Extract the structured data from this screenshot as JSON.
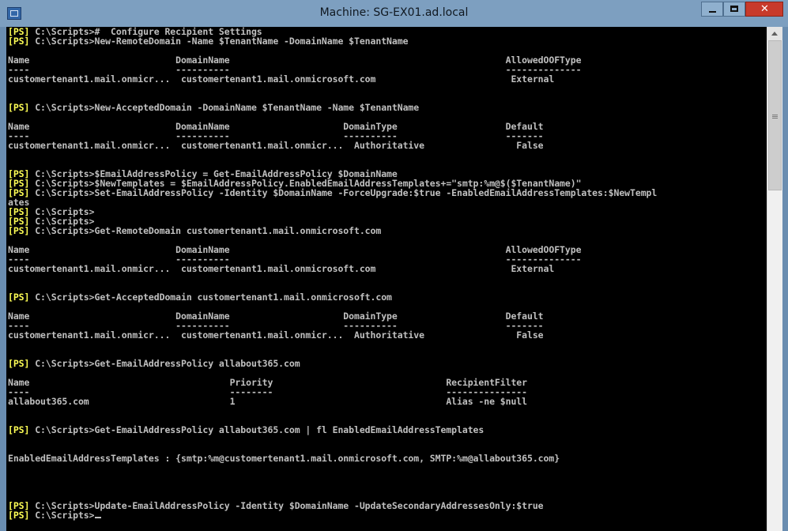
{
  "window": {
    "title": "Machine: SG-EX01.ad.local",
    "controls": {
      "minimize": "minimize",
      "maximize": "maximize",
      "close": "✕"
    }
  },
  "console": {
    "prompt_tag": "[PS]",
    "lines": [
      {
        "prompt": true,
        "text": " C:\\Scripts>#  Configure Recipient Settings"
      },
      {
        "prompt": true,
        "text": " C:\\Scripts>New-RemoteDomain -Name $TenantName -DomainName $TenantName"
      },
      {
        "prompt": false,
        "text": ""
      },
      {
        "prompt": false,
        "text": "Name                           DomainName                                                   AllowedOOFType"
      },
      {
        "prompt": false,
        "text": "----                           ----------                                                   --------------"
      },
      {
        "prompt": false,
        "text": "customertenant1.mail.onmicr...  customertenant1.mail.onmicrosoft.com                         External"
      },
      {
        "prompt": false,
        "text": ""
      },
      {
        "prompt": false,
        "text": ""
      },
      {
        "prompt": true,
        "text": " C:\\Scripts>New-AcceptedDomain -DomainName $TenantName -Name $TenantName"
      },
      {
        "prompt": false,
        "text": ""
      },
      {
        "prompt": false,
        "text": "Name                           DomainName                     DomainType                    Default"
      },
      {
        "prompt": false,
        "text": "----                           ----------                     ----------                    -------"
      },
      {
        "prompt": false,
        "text": "customertenant1.mail.onmicr...  customertenant1.mail.onmicr...  Authoritative                 False"
      },
      {
        "prompt": false,
        "text": ""
      },
      {
        "prompt": false,
        "text": ""
      },
      {
        "prompt": true,
        "text": " C:\\Scripts>$EmailAddressPolicy = Get-EmailAddressPolicy $DomainName"
      },
      {
        "prompt": true,
        "text": " C:\\Scripts>$NewTemplates = $EmailAddressPolicy.EnabledEmailAddressTemplates+=\"smtp:%m@$($TenantName)\""
      },
      {
        "prompt": true,
        "text": " C:\\Scripts>Set-EmailAddressPolicy -Identity $DomainName -ForceUpgrade:$true -EnabledEmailAddressTemplates:$NewTempl"
      },
      {
        "prompt": false,
        "text": "ates"
      },
      {
        "prompt": true,
        "text": " C:\\Scripts>"
      },
      {
        "prompt": true,
        "text": " C:\\Scripts>"
      },
      {
        "prompt": true,
        "text": " C:\\Scripts>Get-RemoteDomain customertenant1.mail.onmicrosoft.com"
      },
      {
        "prompt": false,
        "text": ""
      },
      {
        "prompt": false,
        "text": "Name                           DomainName                                                   AllowedOOFType"
      },
      {
        "prompt": false,
        "text": "----                           ----------                                                   --------------"
      },
      {
        "prompt": false,
        "text": "customertenant1.mail.onmicr...  customertenant1.mail.onmicrosoft.com                         External"
      },
      {
        "prompt": false,
        "text": ""
      },
      {
        "prompt": false,
        "text": ""
      },
      {
        "prompt": true,
        "text": " C:\\Scripts>Get-AcceptedDomain customertenant1.mail.onmicrosoft.com"
      },
      {
        "prompt": false,
        "text": ""
      },
      {
        "prompt": false,
        "text": "Name                           DomainName                     DomainType                    Default"
      },
      {
        "prompt": false,
        "text": "----                           ----------                     ----------                    -------"
      },
      {
        "prompt": false,
        "text": "customertenant1.mail.onmicr...  customertenant1.mail.onmicr...  Authoritative                 False"
      },
      {
        "prompt": false,
        "text": ""
      },
      {
        "prompt": false,
        "text": ""
      },
      {
        "prompt": true,
        "text": " C:\\Scripts>Get-EmailAddressPolicy allabout365.com"
      },
      {
        "prompt": false,
        "text": ""
      },
      {
        "prompt": false,
        "text": "Name                                     Priority                                RecipientFilter"
      },
      {
        "prompt": false,
        "text": "----                                     --------                                ---------------"
      },
      {
        "prompt": false,
        "text": "allabout365.com                          1                                       Alias -ne $null"
      },
      {
        "prompt": false,
        "text": ""
      },
      {
        "prompt": false,
        "text": ""
      },
      {
        "prompt": true,
        "text": " C:\\Scripts>Get-EmailAddressPolicy allabout365.com | fl EnabledEmailAddressTemplates"
      },
      {
        "prompt": false,
        "text": ""
      },
      {
        "prompt": false,
        "text": ""
      },
      {
        "prompt": false,
        "text": "EnabledEmailAddressTemplates : {smtp:%m@customertenant1.mail.onmicrosoft.com, SMTP:%m@allabout365.com}"
      },
      {
        "prompt": false,
        "text": ""
      },
      {
        "prompt": false,
        "text": ""
      },
      {
        "prompt": false,
        "text": ""
      },
      {
        "prompt": false,
        "text": ""
      },
      {
        "prompt": true,
        "text": " C:\\Scripts>Update-EmailAddressPolicy -Identity $DomainName -UpdateSecondaryAddressesOnly:$true"
      },
      {
        "prompt": true,
        "text": " C:\\Scripts>",
        "cursor": true
      }
    ]
  },
  "colors": {
    "prompt_tag": "#ffff55",
    "text": "#c0c0c0",
    "background": "#000000"
  },
  "icons": {
    "app_icon": "powershell-remote-icon",
    "scroll_up": "arrow-up-icon"
  }
}
